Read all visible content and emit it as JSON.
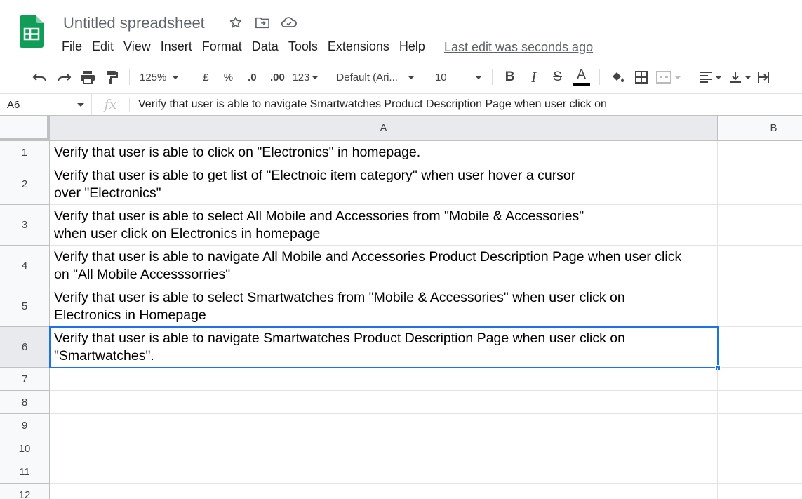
{
  "app": {
    "title": "Untitled spreadsheet",
    "brand_color": "#0f9d58",
    "selection_color": "#1a73e8"
  },
  "menu": [
    "File",
    "Edit",
    "View",
    "Insert",
    "Format",
    "Data",
    "Tools",
    "Extensions",
    "Help"
  ],
  "last_edit": "Last edit was seconds ago",
  "toolbar": {
    "zoom": "125%",
    "currency": "£",
    "percent": "%",
    "decrease_decimal": ".0",
    "increase_decimal": ".00",
    "number_format": "123",
    "font": "Default (Ari...",
    "font_size": "10",
    "icons": [
      "undo-icon",
      "redo-icon",
      "print-icon",
      "paint-format-icon",
      "bold-icon",
      "italic-icon",
      "strikethrough-icon",
      "text-color-icon",
      "fill-color-icon",
      "borders-icon",
      "merge-cells-icon",
      "align-left-icon",
      "vertical-align-icon",
      "text-wrap-icon"
    ]
  },
  "formula_bar": {
    "cell_ref": "A6",
    "fx": "fx",
    "content": "Verify that user is able to navigate Smartwatches Product Description Page when user click on"
  },
  "sheet": {
    "columns": [
      "A",
      "B"
    ],
    "selected_column": "A",
    "selected_row": "6",
    "rows": [
      {
        "num": "1",
        "A": "Verify that user is able to click on \"Electronics\" in homepage.",
        "B": ""
      },
      {
        "num": "2",
        "A": "Verify that user is able to get list of \"Electnoic item category\" when user hover a cursor\nover \"Electronics\"",
        "B": ""
      },
      {
        "num": "3",
        "A": "Verify that user is able to select All Mobile and Accessories from \"Mobile & Accessories\"\nwhen user click on Electronics in homepage",
        "B": ""
      },
      {
        "num": "4",
        "A": "Verify that user is able to navigate All Mobile and Accessories Product Description Page when user click\non \"All Mobile Accesssorries\"",
        "B": ""
      },
      {
        "num": "5",
        "A": "Verify that user is able to select Smartwatches from \"Mobile & Accessories\" when user click on\nElectronics in Homepage",
        "B": ""
      },
      {
        "num": "6",
        "A": "Verify that user is able to navigate Smartwatches Product Description Page when user click on\n\"Smartwatches\".",
        "B": ""
      },
      {
        "num": "7",
        "A": "",
        "B": ""
      },
      {
        "num": "8",
        "A": "",
        "B": ""
      },
      {
        "num": "9",
        "A": "",
        "B": ""
      },
      {
        "num": "10",
        "A": "",
        "B": ""
      },
      {
        "num": "11",
        "A": "",
        "B": ""
      },
      {
        "num": "12",
        "A": "",
        "B": ""
      }
    ]
  }
}
